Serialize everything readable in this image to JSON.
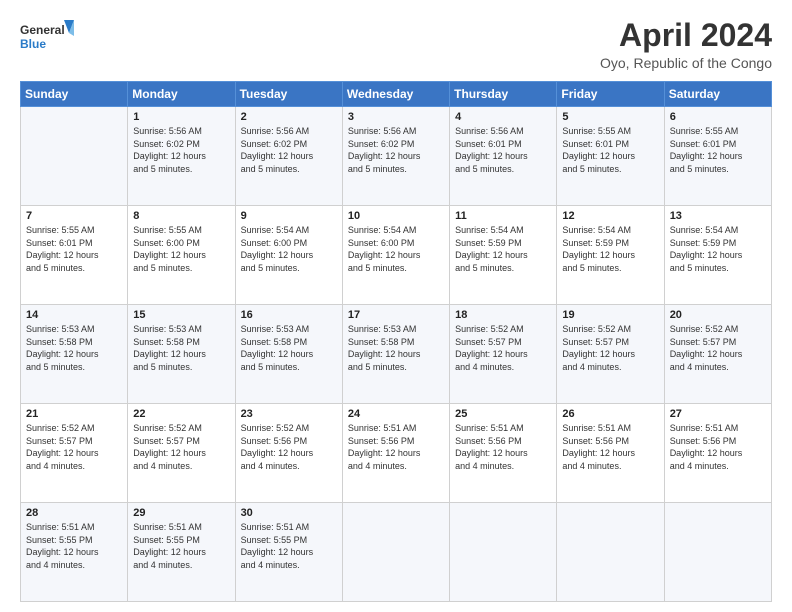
{
  "logo": {
    "line1": "General",
    "line2": "Blue"
  },
  "title": "April 2024",
  "subtitle": "Oyo, Republic of the Congo",
  "days": [
    "Sunday",
    "Monday",
    "Tuesday",
    "Wednesday",
    "Thursday",
    "Friday",
    "Saturday"
  ],
  "weeks": [
    [
      {
        "day": "",
        "text": ""
      },
      {
        "day": "1",
        "text": "Sunrise: 5:56 AM\nSunset: 6:02 PM\nDaylight: 12 hours\nand 5 minutes."
      },
      {
        "day": "2",
        "text": "Sunrise: 5:56 AM\nSunset: 6:02 PM\nDaylight: 12 hours\nand 5 minutes."
      },
      {
        "day": "3",
        "text": "Sunrise: 5:56 AM\nSunset: 6:02 PM\nDaylight: 12 hours\nand 5 minutes."
      },
      {
        "day": "4",
        "text": "Sunrise: 5:56 AM\nSunset: 6:01 PM\nDaylight: 12 hours\nand 5 minutes."
      },
      {
        "day": "5",
        "text": "Sunrise: 5:55 AM\nSunset: 6:01 PM\nDaylight: 12 hours\nand 5 minutes."
      },
      {
        "day": "6",
        "text": "Sunrise: 5:55 AM\nSunset: 6:01 PM\nDaylight: 12 hours\nand 5 minutes."
      }
    ],
    [
      {
        "day": "7",
        "text": "Sunrise: 5:55 AM\nSunset: 6:01 PM\nDaylight: 12 hours\nand 5 minutes."
      },
      {
        "day": "8",
        "text": "Sunrise: 5:55 AM\nSunset: 6:00 PM\nDaylight: 12 hours\nand 5 minutes."
      },
      {
        "day": "9",
        "text": "Sunrise: 5:54 AM\nSunset: 6:00 PM\nDaylight: 12 hours\nand 5 minutes."
      },
      {
        "day": "10",
        "text": "Sunrise: 5:54 AM\nSunset: 6:00 PM\nDaylight: 12 hours\nand 5 minutes."
      },
      {
        "day": "11",
        "text": "Sunrise: 5:54 AM\nSunset: 5:59 PM\nDaylight: 12 hours\nand 5 minutes."
      },
      {
        "day": "12",
        "text": "Sunrise: 5:54 AM\nSunset: 5:59 PM\nDaylight: 12 hours\nand 5 minutes."
      },
      {
        "day": "13",
        "text": "Sunrise: 5:54 AM\nSunset: 5:59 PM\nDaylight: 12 hours\nand 5 minutes."
      }
    ],
    [
      {
        "day": "14",
        "text": "Sunrise: 5:53 AM\nSunset: 5:58 PM\nDaylight: 12 hours\nand 5 minutes."
      },
      {
        "day": "15",
        "text": "Sunrise: 5:53 AM\nSunset: 5:58 PM\nDaylight: 12 hours\nand 5 minutes."
      },
      {
        "day": "16",
        "text": "Sunrise: 5:53 AM\nSunset: 5:58 PM\nDaylight: 12 hours\nand 5 minutes."
      },
      {
        "day": "17",
        "text": "Sunrise: 5:53 AM\nSunset: 5:58 PM\nDaylight: 12 hours\nand 5 minutes."
      },
      {
        "day": "18",
        "text": "Sunrise: 5:52 AM\nSunset: 5:57 PM\nDaylight: 12 hours\nand 4 minutes."
      },
      {
        "day": "19",
        "text": "Sunrise: 5:52 AM\nSunset: 5:57 PM\nDaylight: 12 hours\nand 4 minutes."
      },
      {
        "day": "20",
        "text": "Sunrise: 5:52 AM\nSunset: 5:57 PM\nDaylight: 12 hours\nand 4 minutes."
      }
    ],
    [
      {
        "day": "21",
        "text": "Sunrise: 5:52 AM\nSunset: 5:57 PM\nDaylight: 12 hours\nand 4 minutes."
      },
      {
        "day": "22",
        "text": "Sunrise: 5:52 AM\nSunset: 5:57 PM\nDaylight: 12 hours\nand 4 minutes."
      },
      {
        "day": "23",
        "text": "Sunrise: 5:52 AM\nSunset: 5:56 PM\nDaylight: 12 hours\nand 4 minutes."
      },
      {
        "day": "24",
        "text": "Sunrise: 5:51 AM\nSunset: 5:56 PM\nDaylight: 12 hours\nand 4 minutes."
      },
      {
        "day": "25",
        "text": "Sunrise: 5:51 AM\nSunset: 5:56 PM\nDaylight: 12 hours\nand 4 minutes."
      },
      {
        "day": "26",
        "text": "Sunrise: 5:51 AM\nSunset: 5:56 PM\nDaylight: 12 hours\nand 4 minutes."
      },
      {
        "day": "27",
        "text": "Sunrise: 5:51 AM\nSunset: 5:56 PM\nDaylight: 12 hours\nand 4 minutes."
      }
    ],
    [
      {
        "day": "28",
        "text": "Sunrise: 5:51 AM\nSunset: 5:55 PM\nDaylight: 12 hours\nand 4 minutes."
      },
      {
        "day": "29",
        "text": "Sunrise: 5:51 AM\nSunset: 5:55 PM\nDaylight: 12 hours\nand 4 minutes."
      },
      {
        "day": "30",
        "text": "Sunrise: 5:51 AM\nSunset: 5:55 PM\nDaylight: 12 hours\nand 4 minutes."
      },
      {
        "day": "",
        "text": ""
      },
      {
        "day": "",
        "text": ""
      },
      {
        "day": "",
        "text": ""
      },
      {
        "day": "",
        "text": ""
      }
    ]
  ]
}
